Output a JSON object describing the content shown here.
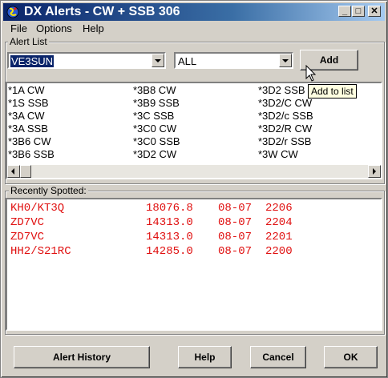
{
  "window": {
    "title": "DX Alerts - CW + SSB 306",
    "min_label": "_",
    "max_label": "□",
    "close_label": "✕"
  },
  "menu": [
    "File",
    "Options",
    "Help"
  ],
  "alert_list": {
    "group_label": "Alert List",
    "call_value": "VE3SUN",
    "mode_value": "ALL",
    "add_label": "Add",
    "tooltip": "Add to list",
    "columns": [
      [
        "*1A CW",
        "*1S SSB",
        "*3A CW",
        "*3A SSB",
        "*3B6 CW",
        "*3B6 SSB"
      ],
      [
        "*3B8 CW",
        "*3B9 SSB",
        "*3C SSB",
        "*3C0 CW",
        "*3C0 SSB",
        "*3D2 CW"
      ],
      [
        "*3D2 SSB",
        "*3D2/C CW",
        "*3D2/c SSB",
        "*3D2/R CW",
        "*3D2/r SSB",
        "*3W CW"
      ]
    ]
  },
  "recent": {
    "group_label": "Recently Spotted:",
    "rows": [
      {
        "call": "KH0/KT3Q",
        "freq": "18076.8",
        "date": "08-07",
        "time": "2206"
      },
      {
        "call": "ZD7VC",
        "freq": "14313.0",
        "date": "08-07",
        "time": "2204"
      },
      {
        "call": "ZD7VC",
        "freq": "14313.0",
        "date": "08-07",
        "time": "2201"
      },
      {
        "call": "HH2/S21RC",
        "freq": "14285.0",
        "date": "08-07",
        "time": "2200"
      }
    ]
  },
  "buttons": {
    "history": "Alert History",
    "help": "Help",
    "cancel": "Cancel",
    "ok": "OK"
  },
  "colors": {
    "spot_text": "#e01010",
    "title_bar": "#0a246a"
  }
}
